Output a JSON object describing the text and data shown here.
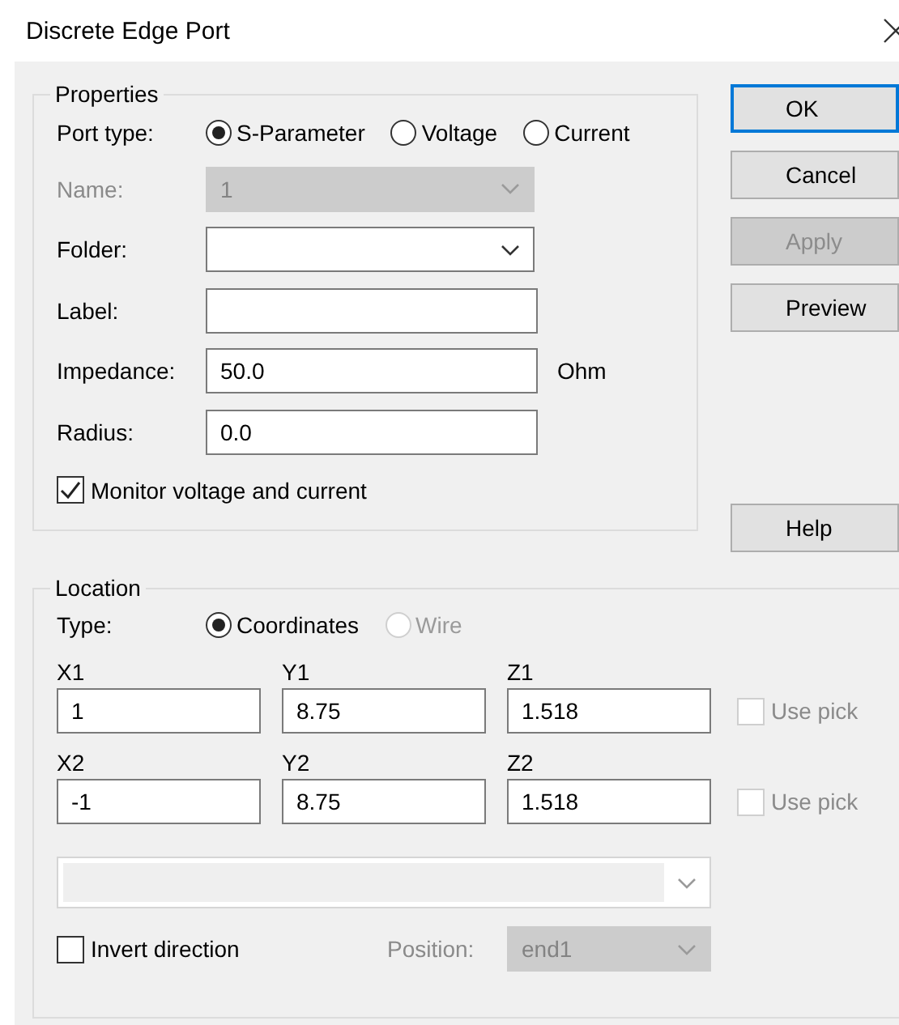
{
  "window": {
    "title": "Discrete Edge Port"
  },
  "properties": {
    "title": "Properties",
    "port_type": {
      "label": "Port type:",
      "options": [
        {
          "label": "S-Parameter",
          "selected": true
        },
        {
          "label": "Voltage",
          "selected": false
        },
        {
          "label": "Current",
          "selected": false
        }
      ]
    },
    "fields": [
      {
        "kind": "dropdown",
        "label": "Name:",
        "value": "1",
        "disabled": true
      },
      {
        "kind": "dropdown",
        "label": "Folder:",
        "disabled": false
      },
      {
        "kind": "text",
        "label": "Label:"
      },
      {
        "kind": "text",
        "label": "Impedance:",
        "value": "50.0",
        "unit": "Ohm"
      },
      {
        "kind": "text",
        "label": "Radius:",
        "value": "0.0"
      }
    ],
    "monitor": {
      "label": "Monitor voltage and current",
      "checked": true
    }
  },
  "buttons": [
    {
      "label": "OK",
      "default": true,
      "disabled": false
    },
    {
      "label": "Cancel",
      "default": false,
      "disabled": false
    },
    {
      "label": "Apply",
      "default": false,
      "disabled": true
    },
    {
      "label": "Preview",
      "default": false,
      "disabled": false
    }
  ],
  "help_button": {
    "label": "Help"
  },
  "location": {
    "title": "Location",
    "type": {
      "label": "Type:",
      "options": [
        {
          "label": "Coordinates",
          "selected": true,
          "disabled": false
        },
        {
          "label": "Wire",
          "selected": false,
          "disabled": true
        }
      ]
    },
    "points": [
      {
        "fields": [
          {
            "label": "X1",
            "value": "1"
          },
          {
            "label": "Y1",
            "value": "8.75"
          },
          {
            "label": "Z1",
            "value": "1.518"
          }
        ],
        "use_pick": {
          "label": "Use pick",
          "checked": false,
          "disabled": true
        }
      },
      {
        "fields": [
          {
            "label": "X2",
            "value": "-1"
          },
          {
            "label": "Y2",
            "value": "8.75"
          },
          {
            "label": "Z2",
            "value": "1.518"
          }
        ],
        "use_pick": {
          "label": "Use pick",
          "checked": false,
          "disabled": true
        }
      }
    ],
    "wire_dropdown": {
      "disabled": true
    },
    "invert": {
      "label": "Invert direction",
      "checked": false
    },
    "position": {
      "label": "Position:",
      "value": "end1",
      "disabled": true
    }
  }
}
